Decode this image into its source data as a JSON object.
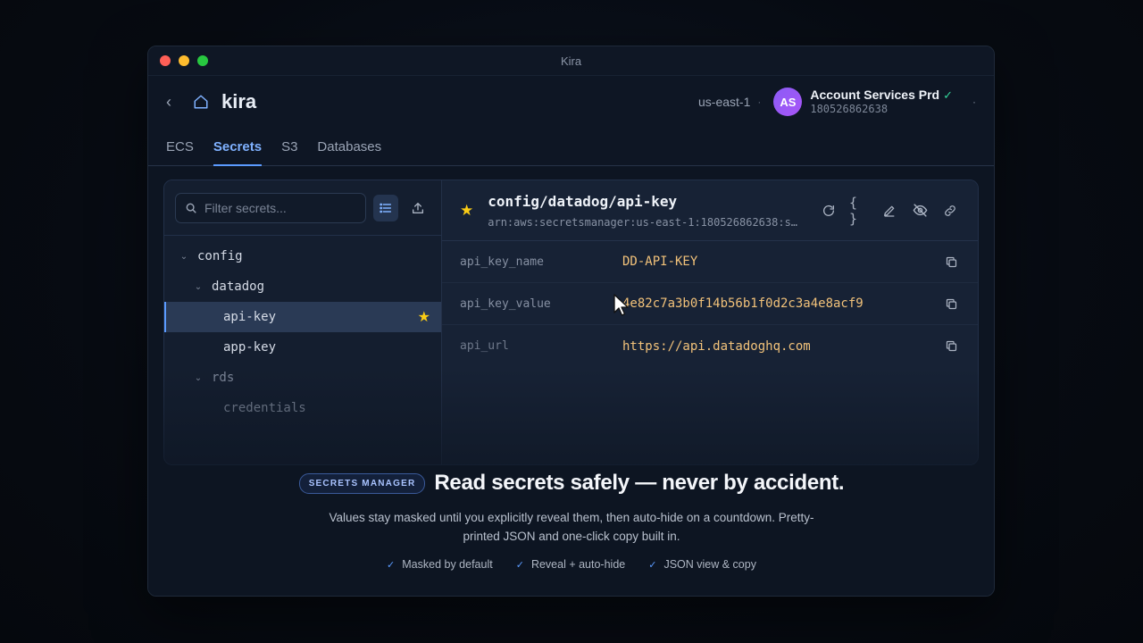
{
  "window": {
    "title": "Kira"
  },
  "header": {
    "back_glyph": "‹",
    "app_name": "kira",
    "region": "us-east-1",
    "account": {
      "initials": "AS",
      "name": "Account Services Prd",
      "id": "180526862638",
      "verified_glyph": "✓"
    }
  },
  "tabs": [
    {
      "label": "ECS",
      "active": false
    },
    {
      "label": "Secrets",
      "active": true
    },
    {
      "label": "S3",
      "active": false
    },
    {
      "label": "Databases",
      "active": false
    }
  ],
  "sidebar": {
    "search_placeholder": "Filter secrets...",
    "tree": [
      {
        "label": "config",
        "level": 0,
        "expanded": true
      },
      {
        "label": "datadog",
        "level": 1,
        "expanded": true
      },
      {
        "label": "api-key",
        "level": 2,
        "selected": true,
        "starred": true
      },
      {
        "label": "app-key",
        "level": 2
      },
      {
        "label": "rds",
        "level": 1,
        "expanded": true
      },
      {
        "label": "credentials",
        "level": 2
      }
    ]
  },
  "detail": {
    "path": "config/datadog/api-key",
    "arn": "arn:aws:secretsmanager:us-east-1:180526862638:s…",
    "actions": [
      "refresh-icon",
      "json-braces-icon",
      "edit-pencil-icon",
      "hide-eye-icon",
      "link-icon"
    ],
    "json_glyph": "{ }",
    "fields": [
      {
        "key": "api_key_name",
        "value": "DD-API-KEY"
      },
      {
        "key": "api_key_value",
        "value": "4e82c7a3b0f14b56b1f0d2c3a4e8acf9"
      },
      {
        "key": "api_url",
        "value": "https://api.datadoghq.com"
      }
    ]
  },
  "promo": {
    "badge": "SECRETS MANAGER",
    "title": "Read secrets safely — never by accident.",
    "description": "Values stay masked until you explicitly reveal them, then auto-hide on a countdown. Pretty-printed JSON and one-click copy built in.",
    "features": [
      "Masked by default",
      "Reveal + auto-hide",
      "JSON view & copy"
    ]
  },
  "colors": {
    "accent": "#5b9bff",
    "star": "#facc15",
    "value": "#f2c27a",
    "verified": "#34d399"
  }
}
